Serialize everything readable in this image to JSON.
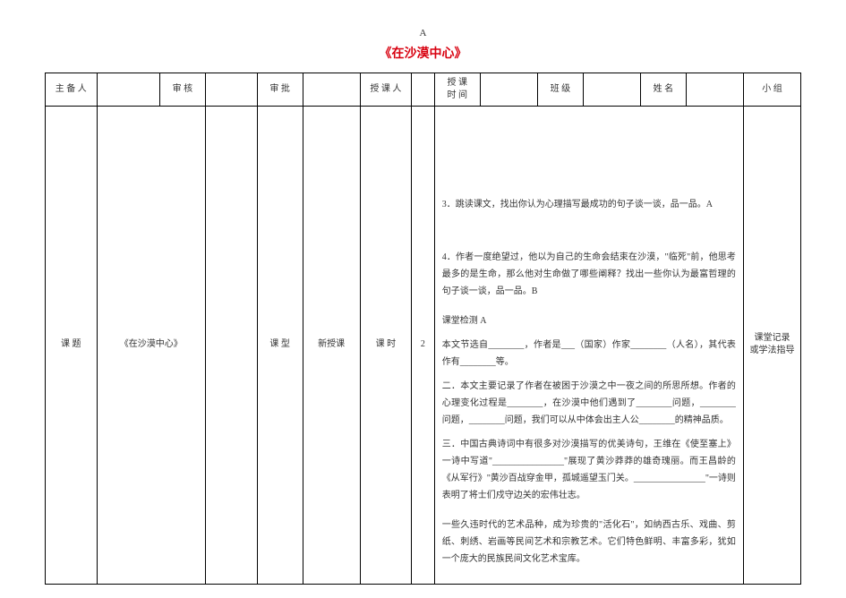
{
  "top_letter": "A",
  "title": "《在沙漠中心》",
  "header_row": {
    "c1": "主 备 人",
    "c2": "",
    "c3": "审 核",
    "c4": "",
    "c5": "审 批",
    "c6": "",
    "c7": "授 课 人",
    "c8": "",
    "c9": "授 课\n时 间",
    "c10": "",
    "c11": "班 级",
    "c12": "",
    "c13": "姓 名",
    "c14": "",
    "c15": "小 组"
  },
  "body_row": {
    "c1": "课 题",
    "c2": "《在沙漠中心》",
    "c3": "",
    "c4": "课 型",
    "c5": "新授课",
    "c6": "课 时",
    "c7": "2",
    "c8_content": {
      "p1": "3．跳读课文，找出你认为心理描写最成功的句子谈一谈，品一品。A",
      "p2": "4．作者一度绝望过，他以为自己的生命会结束在沙漠，\"临死\"前，他思考最多的是生命，那么他对生命做了哪些阐释？找出一些你认为最富哲理的句子谈一谈，品一品。B",
      "sec_title": "课堂检测 A",
      "line1_a": "本文节选自________，作者是___（国家）作家________（人名），其代表作有________等。",
      "line2": "二．本文主要记录了作者在被困于沙漠之中一夜之间的所思所想。作者的心理变化过程是________，在沙漠中他们遇到了________问题，________问题，________问题，我们可以从中体会出主人公________的精神品质。",
      "line3": "三．中国古典诗词中有很多对沙漠描写的优美诗句，王维在《使至塞上》一诗中写道\"________________\"展现了黄沙莽莽的雄奇瑰丽。而王昌龄的《从军行》\"黄沙百战穿金甲，孤城遥望玉门关。________________\"一诗则表明了将士们戍守边关的宏伟壮志。",
      "footer": "一些久违时代的艺术品种，成为珍贵的\"活化石\"，如纳西古乐、戏曲、剪纸、刺绣、岩画等民间艺术和宗教艺术。它们特色鲜明、丰富多彩，犹如一个庞大的民族民间文化艺术宝库。"
    },
    "c15": "课堂记录\n或学法指导"
  }
}
